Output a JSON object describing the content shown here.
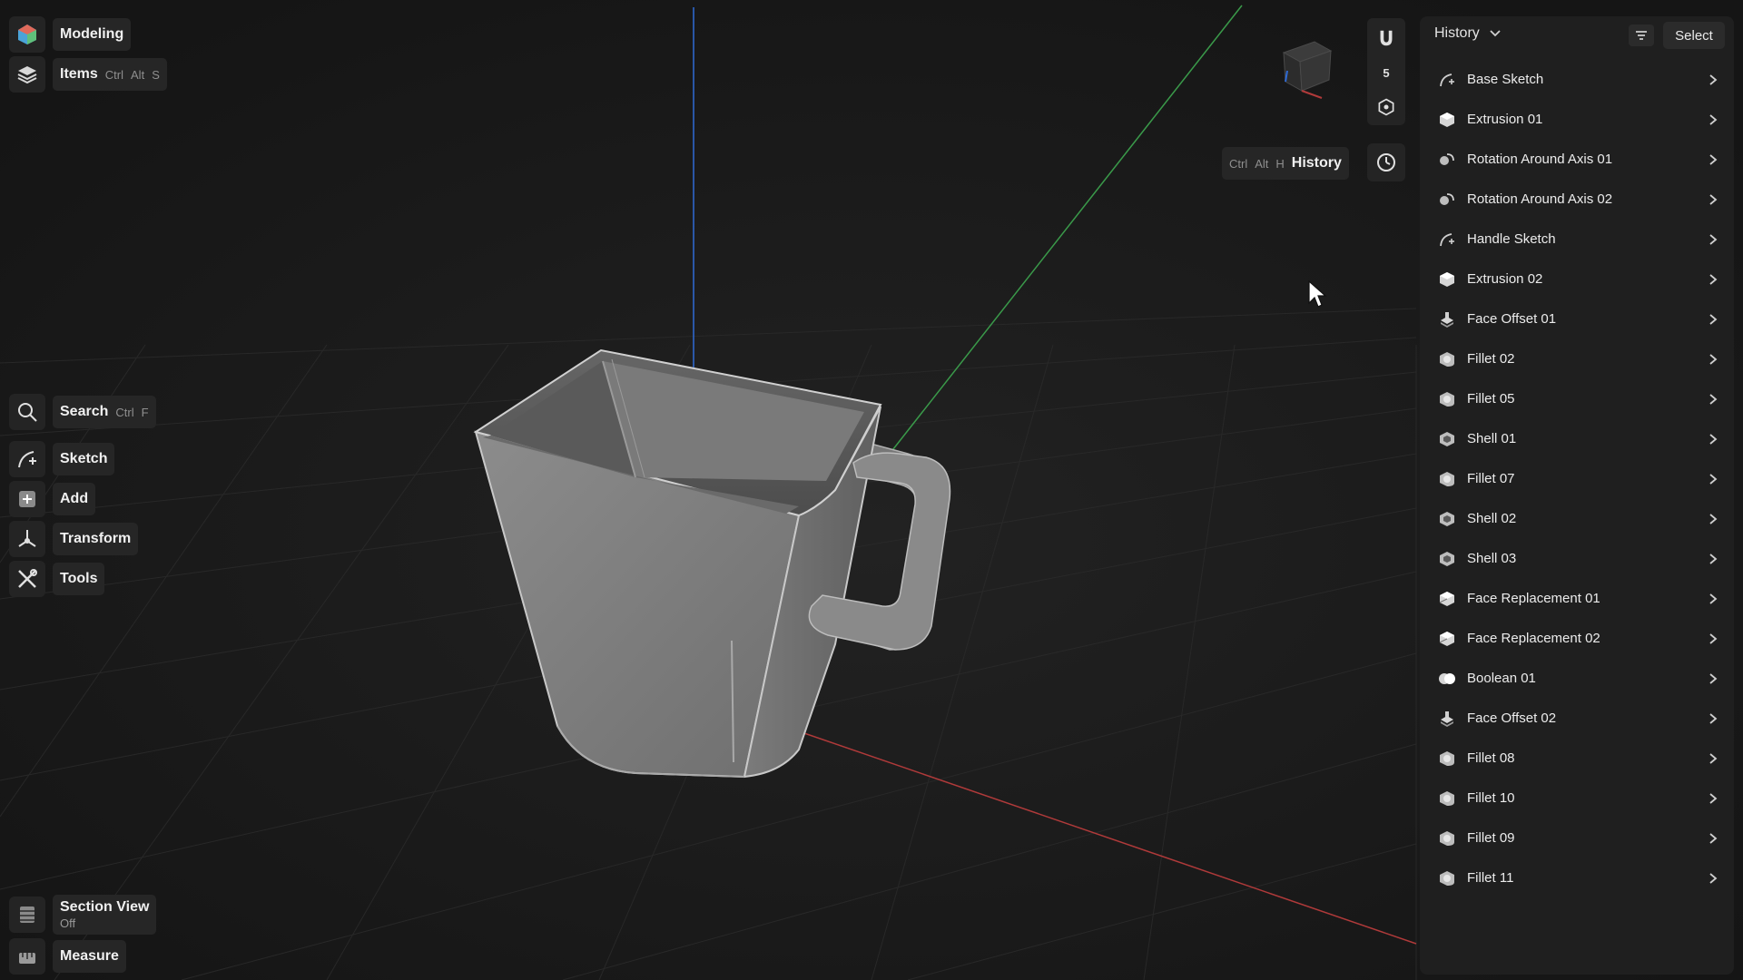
{
  "mode_menu": {
    "label": "Modeling",
    "icon": "app-logo-icon"
  },
  "items_menu": {
    "label": "Items",
    "shortcut": [
      "Ctrl",
      "Alt",
      "S"
    ],
    "icon": "layers-icon"
  },
  "tools_menu": {
    "search": {
      "label": "Search",
      "shortcut": [
        "Ctrl",
        "F"
      ],
      "icon": "search-icon"
    },
    "sketch": {
      "label": "Sketch",
      "icon": "sketch-icon"
    },
    "add": {
      "label": "Add",
      "icon": "add-icon"
    },
    "transform": {
      "label": "Transform",
      "icon": "transform-icon"
    },
    "tools": {
      "label": "Tools",
      "icon": "tools-icon"
    }
  },
  "bottom_tools": {
    "section_view": {
      "label": "Section View",
      "state": "Off",
      "icon": "section-view-icon"
    },
    "measure": {
      "label": "Measure",
      "icon": "measure-icon"
    }
  },
  "history_tooltip": {
    "shortcut": [
      "Ctrl",
      "Alt",
      "H"
    ],
    "label": "History"
  },
  "snap_toolbar": {
    "snap_value": "5"
  },
  "history_panel": {
    "title": "History",
    "select_label": "Select",
    "items": [
      {
        "label": "Base Sketch",
        "icon": "sketch-icon"
      },
      {
        "label": "Extrusion 01",
        "icon": "extrusion-icon"
      },
      {
        "label": "Rotation Around Axis 01",
        "icon": "rotation-icon"
      },
      {
        "label": "Rotation Around Axis 02",
        "icon": "rotation-icon"
      },
      {
        "label": "Handle Sketch",
        "icon": "sketch-icon"
      },
      {
        "label": "Extrusion 02",
        "icon": "extrusion-icon"
      },
      {
        "label": "Face Offset 01",
        "icon": "face-offset-icon"
      },
      {
        "label": "Fillet 02",
        "icon": "fillet-icon"
      },
      {
        "label": "Fillet 05",
        "icon": "fillet-icon"
      },
      {
        "label": "Shell 01",
        "icon": "shell-icon"
      },
      {
        "label": "Fillet 07",
        "icon": "fillet-icon"
      },
      {
        "label": "Shell 02",
        "icon": "shell-icon"
      },
      {
        "label": "Shell 03",
        "icon": "shell-icon"
      },
      {
        "label": "Face Replacement 01",
        "icon": "face-replacement-icon"
      },
      {
        "label": "Face Replacement 02",
        "icon": "face-replacement-icon"
      },
      {
        "label": "Boolean 01",
        "icon": "boolean-icon"
      },
      {
        "label": "Face Offset 02",
        "icon": "face-offset-icon"
      },
      {
        "label": "Fillet 08",
        "icon": "fillet-icon"
      },
      {
        "label": "Fillet 10",
        "icon": "fillet-icon"
      },
      {
        "label": "Fillet 09",
        "icon": "fillet-icon"
      },
      {
        "label": "Fillet 11",
        "icon": "fillet-icon"
      }
    ]
  },
  "colors": {
    "background": "#1a1a1a",
    "panel": "#1f1f1f",
    "button": "#262626",
    "axis_x": "#b03a3a",
    "axis_y": "#3a9a4a",
    "axis_z": "#2f6bd6",
    "model": "#8a8a8a"
  }
}
